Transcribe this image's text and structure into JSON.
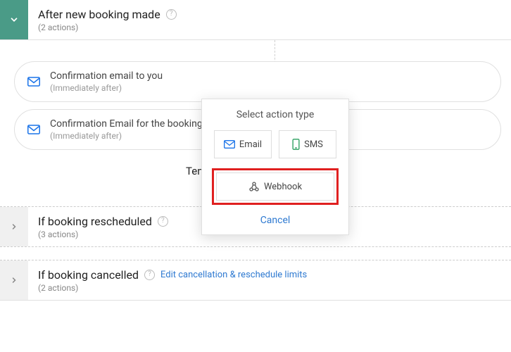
{
  "triggers": {
    "new_booking": {
      "title": "After new booking made",
      "sub": "(2 actions)"
    },
    "rescheduled": {
      "title": "If booking rescheduled",
      "sub": "(3 actions)"
    },
    "cancelled": {
      "title": "If booking cancelled",
      "sub": "(2 actions)",
      "edit_link": "Edit cancellation & reschedule limits"
    }
  },
  "actions": {
    "a1": {
      "title": "Confirmation email to you",
      "sub": "(Immediately after)"
    },
    "a2": {
      "title": "Confirmation Email for the booking",
      "sub": "(Immediately after)"
    }
  },
  "tentative": {
    "label": "Tentative flow:",
    "state": "off"
  },
  "modal": {
    "title": "Select action type",
    "email": "Email",
    "sms": "SMS",
    "webhook": "Webhook",
    "cancel": "Cancel"
  }
}
